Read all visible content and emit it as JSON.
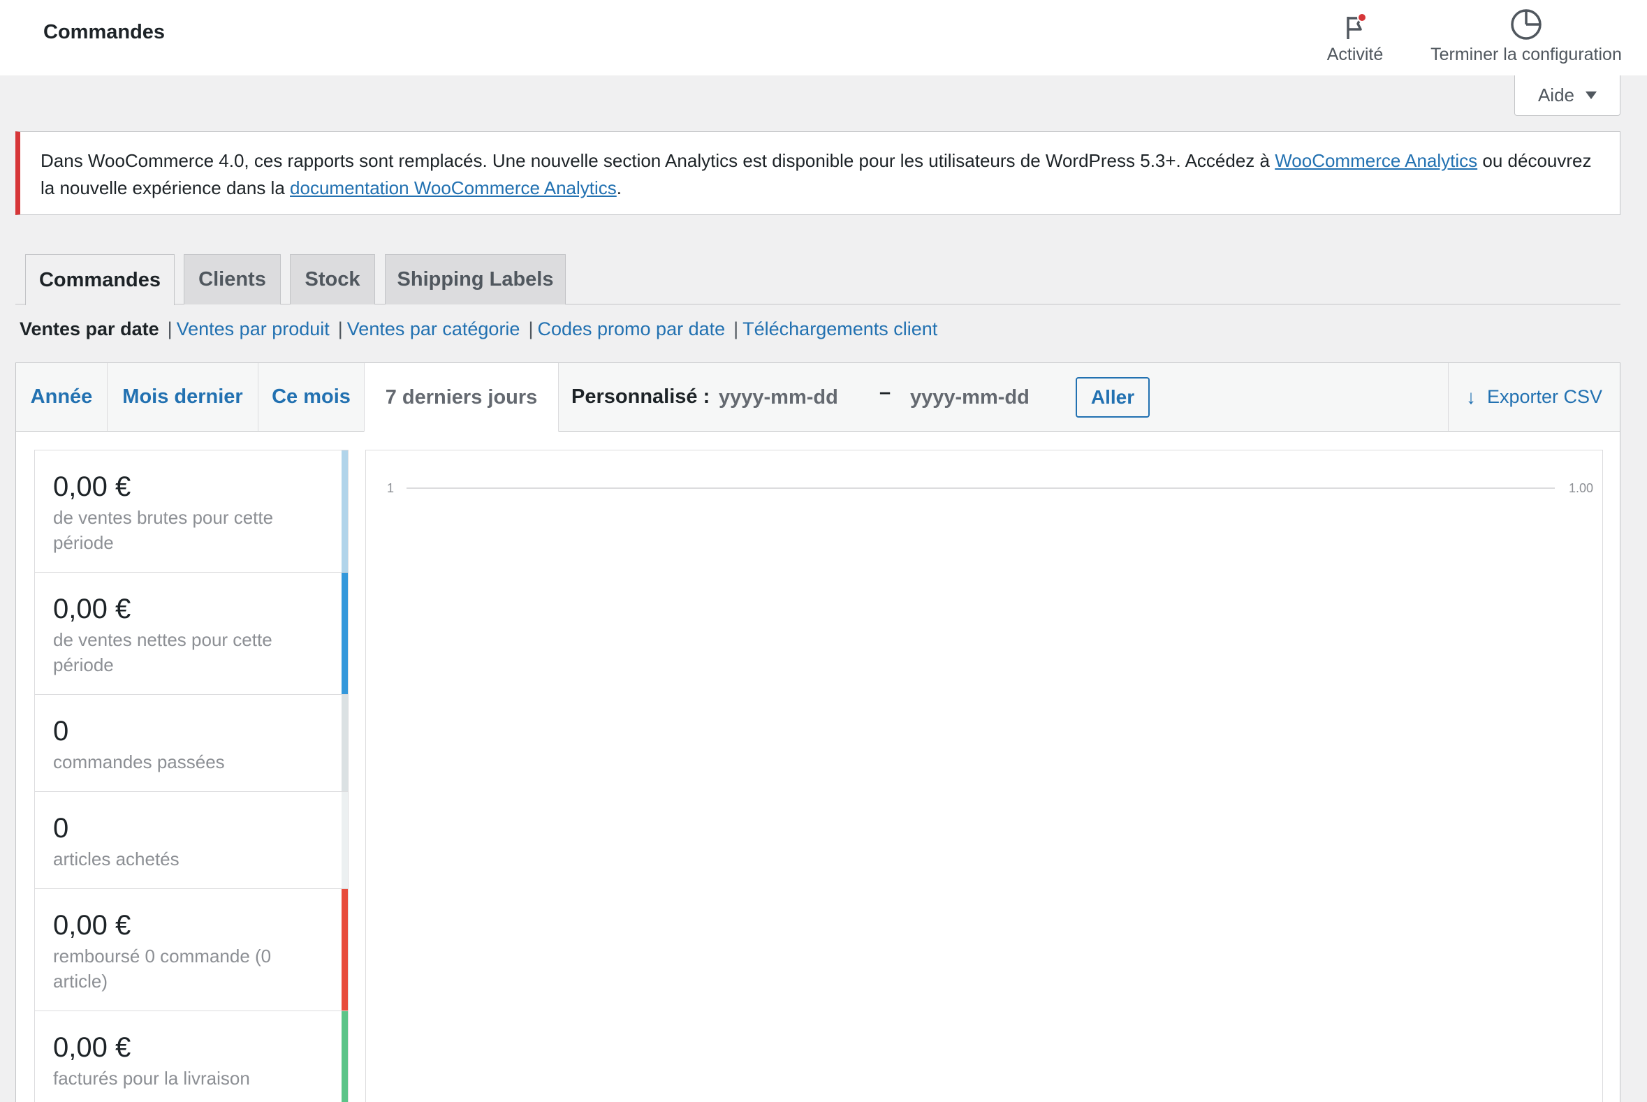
{
  "header": {
    "title": "Commandes",
    "activity_label": "Activité",
    "setup_label": "Terminer la configuration",
    "help_label": "Aide"
  },
  "notice": {
    "text_before": "Dans WooCommerce 4.0, ces rapports sont remplacés. Une nouvelle section Analytics est disponible pour les utilisateurs de WordPress 5.3+. Accédez à ",
    "link1": "WooCommerce Analytics",
    "text_middle": " ou découvrez la nouvelle expérience dans la ",
    "link2": "documentation WooCommerce Analytics",
    "text_after": "."
  },
  "tabs": [
    {
      "label": "Commandes"
    },
    {
      "label": "Clients"
    },
    {
      "label": "Stock"
    },
    {
      "label": "Shipping Labels"
    }
  ],
  "subnav": {
    "current": "Ventes par date",
    "links": [
      "Ventes par produit",
      "Ventes par catégorie",
      "Codes promo par date",
      "Téléchargements client"
    ],
    "separator": "|"
  },
  "ranges": {
    "year": "Année",
    "last_month": "Mois dernier",
    "this_month": "Ce mois",
    "last_7_days": "7 derniers jours",
    "custom_label": "Personnalisé :",
    "date_from_placeholder": "yyyy-mm-dd",
    "date_to_placeholder": "yyyy-mm-dd",
    "dash": "–",
    "go_label": "Aller",
    "export_label": "Exporter CSV"
  },
  "legend": [
    {
      "amount": "0,00 €",
      "desc": "de ventes brutes pour cette période",
      "color": "#b1d4ea"
    },
    {
      "amount": "0,00 €",
      "desc": "de ventes nettes pour cette période",
      "color": "#3498db"
    },
    {
      "amount": "0",
      "desc": "commandes passées",
      "color": "#dbe1e3"
    },
    {
      "amount": "0",
      "desc": "articles achetés",
      "color": "#ecf0f1"
    },
    {
      "amount": "0,00 €",
      "desc": "remboursé 0 commande (0 article)",
      "color": "#e74c3c"
    },
    {
      "amount": "0,00 €",
      "desc": "facturés pour la livraison",
      "color": "#5cc488"
    }
  ],
  "chart_data": {
    "type": "line",
    "y_left_tick": "1",
    "y_right_tick": "1.00",
    "series": []
  },
  "colors": {
    "accent": "#2271b1",
    "notice_error": "#d63638",
    "activity_dot": "#d63638"
  }
}
